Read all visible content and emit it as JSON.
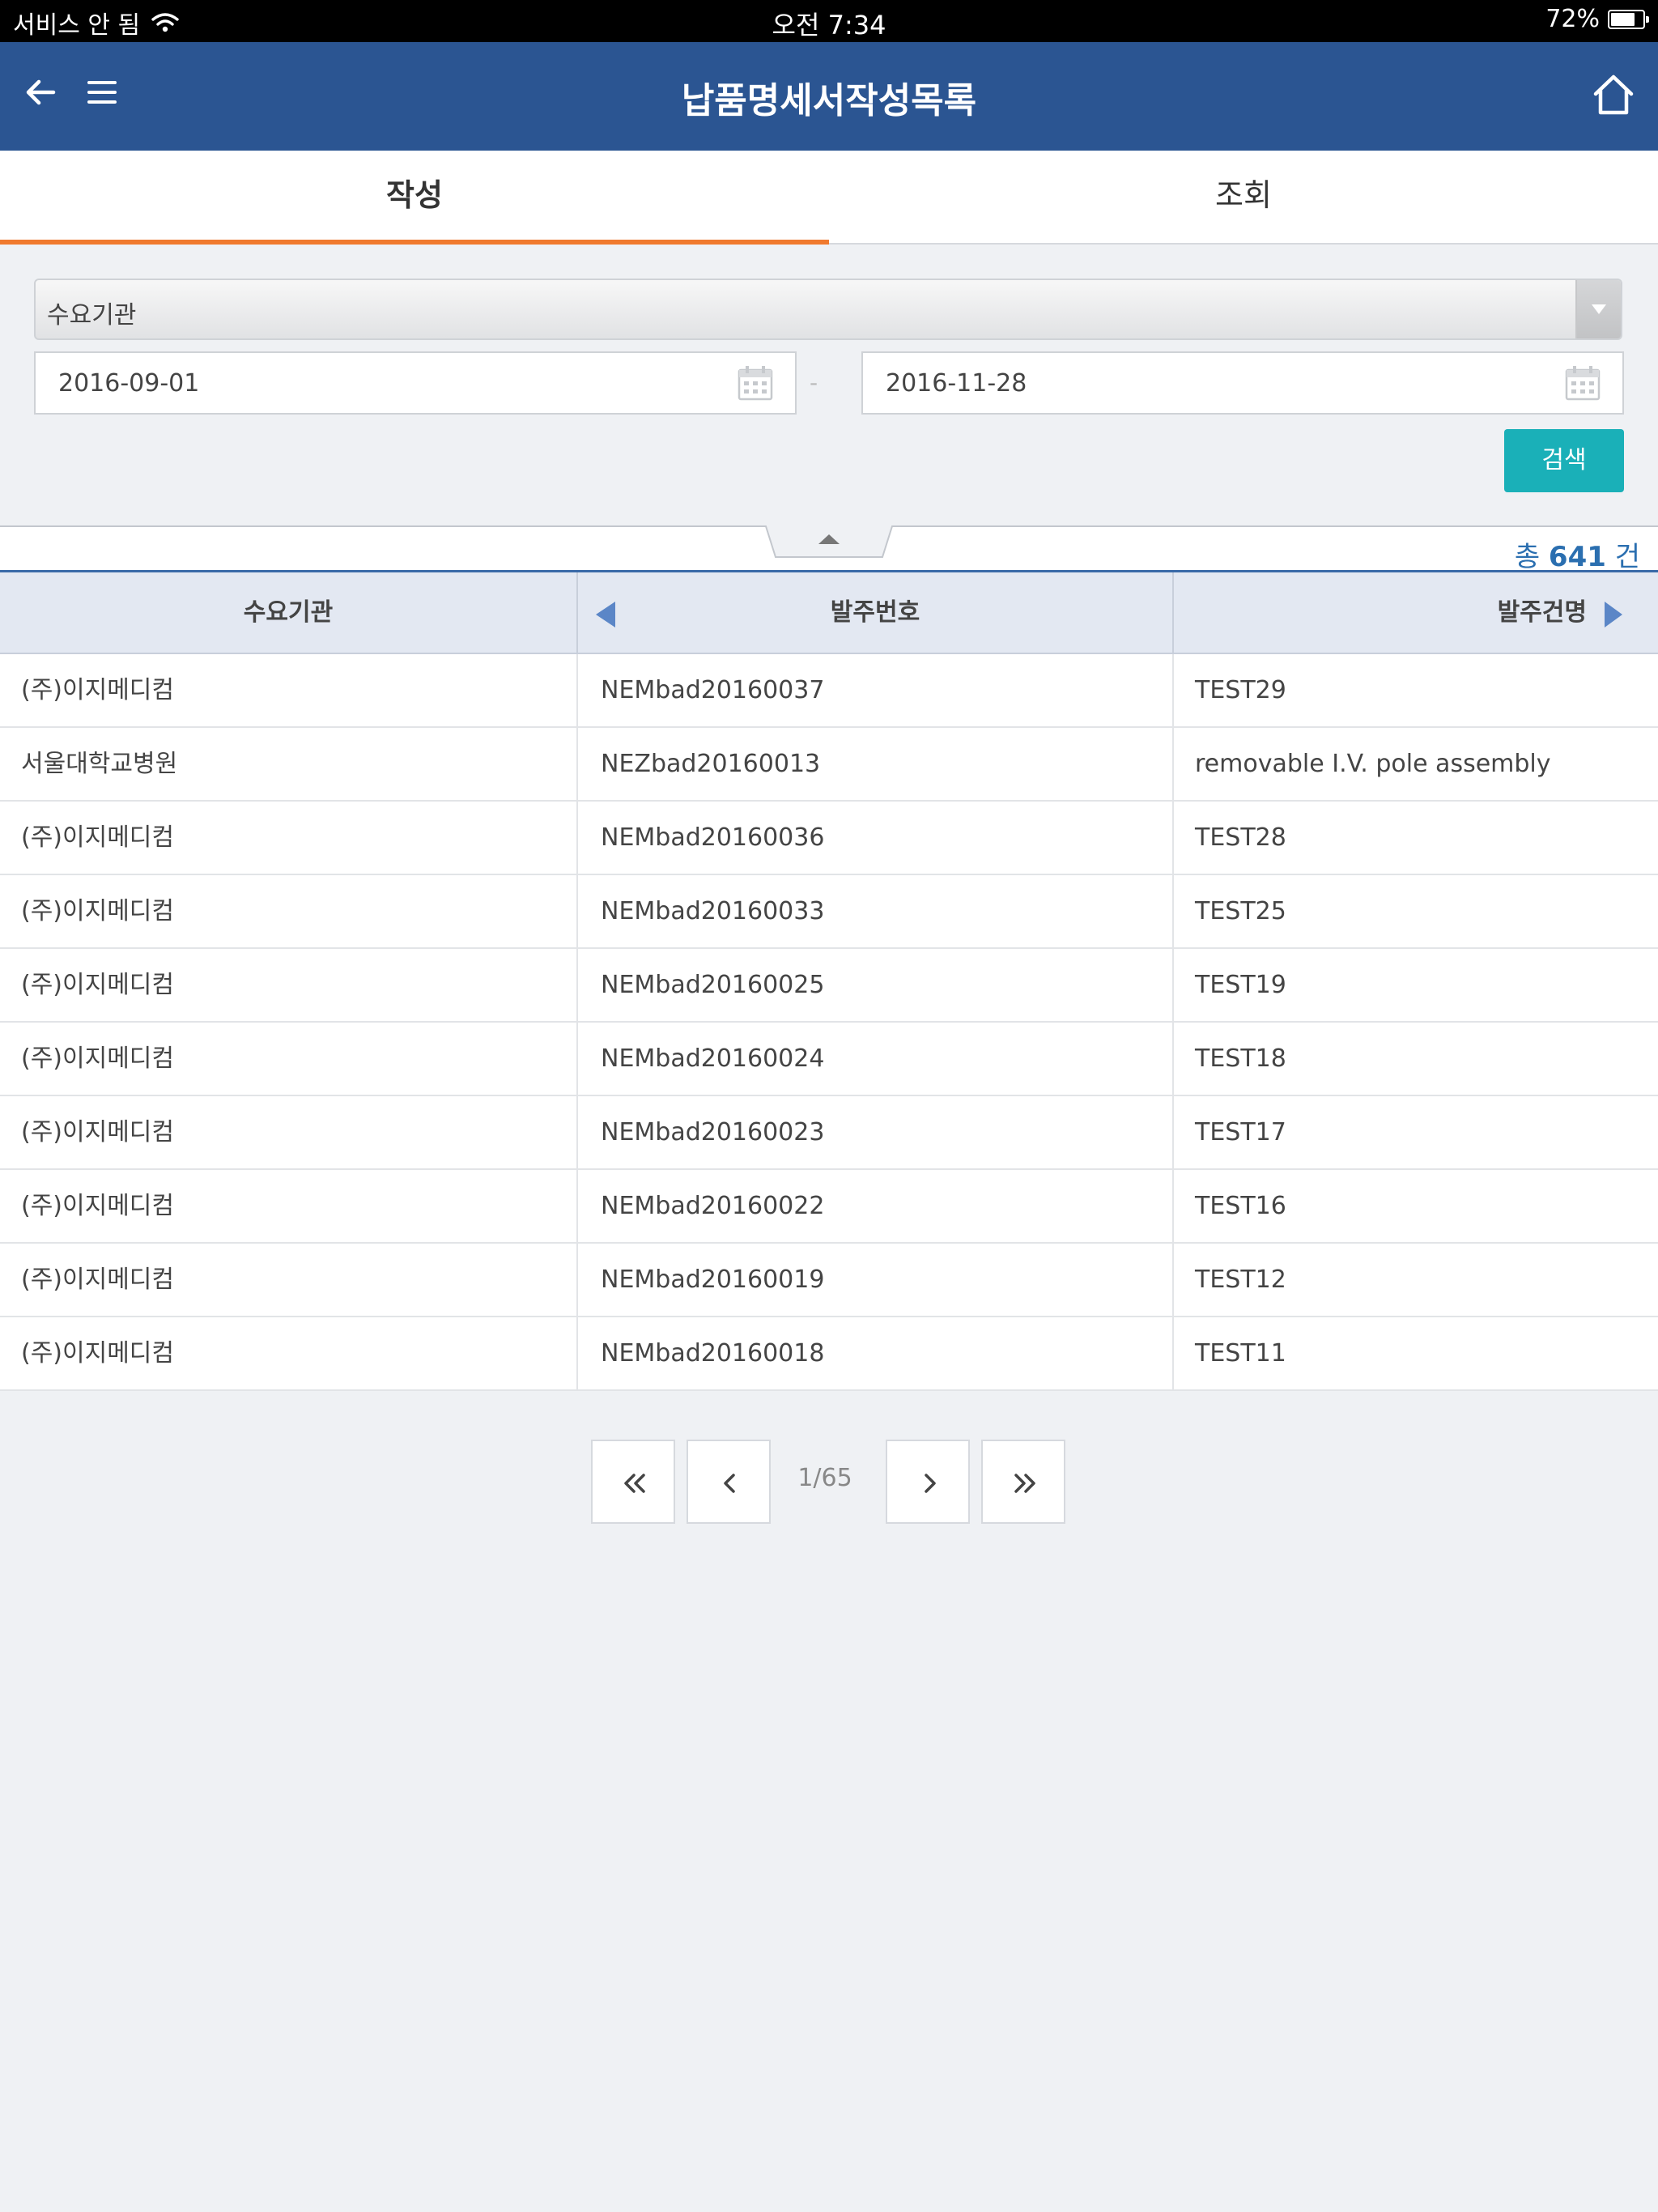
{
  "status_bar": {
    "carrier": "서비스 안 됨",
    "time": "오전 7:34",
    "battery": "72%"
  },
  "header": {
    "title": "납품명세서작성목록"
  },
  "tabs": [
    {
      "label": "작성",
      "active": true
    },
    {
      "label": "조회",
      "active": false
    }
  ],
  "filter": {
    "select_label": "수요기관",
    "start_date": "2016-09-01",
    "date_separator": "-",
    "end_date": "2016-11-28",
    "search_label": "검색"
  },
  "total": {
    "prefix": "총",
    "count": "641",
    "suffix": "건"
  },
  "table": {
    "headers": [
      "수요기관",
      "발주번호",
      "발주건명"
    ],
    "rows": [
      [
        "(주)이지메디컴",
        "NEMbad20160037",
        "TEST29"
      ],
      [
        "서울대학교병원",
        "NEZbad20160013",
        "removable I.V. pole assembly"
      ],
      [
        "(주)이지메디컴",
        "NEMbad20160036",
        "TEST28"
      ],
      [
        "(주)이지메디컴",
        "NEMbad20160033",
        "TEST25"
      ],
      [
        "(주)이지메디컴",
        "NEMbad20160025",
        "TEST19"
      ],
      [
        "(주)이지메디컴",
        "NEMbad20160024",
        "TEST18"
      ],
      [
        "(주)이지메디컴",
        "NEMbad20160023",
        "TEST17"
      ],
      [
        "(주)이지메디컴",
        "NEMbad20160022",
        "TEST16"
      ],
      [
        "(주)이지메디컴",
        "NEMbad20160019",
        "TEST12"
      ],
      [
        "(주)이지메디컴",
        "NEMbad20160018",
        "TEST11"
      ]
    ]
  },
  "pagination": {
    "page_text": "1/65"
  },
  "colors": {
    "header_bg": "#2b5592",
    "tab_accent": "#f07a2e",
    "search_button": "#1ab0b8",
    "total_text": "#2b6fb0"
  }
}
